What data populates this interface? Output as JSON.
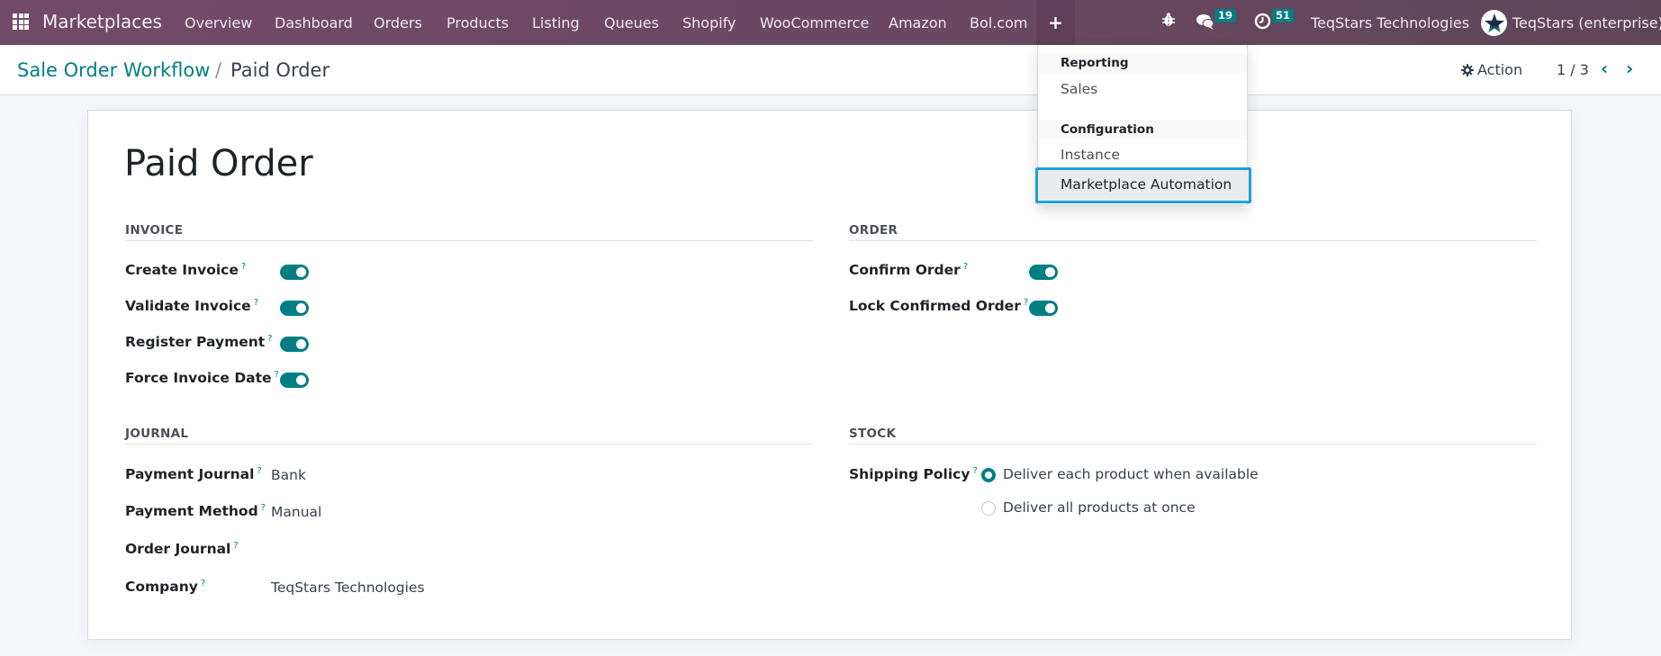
{
  "navbar": {
    "brand": "Marketplaces",
    "menu": [
      "Overview",
      "Dashboard",
      "Orders",
      "Products",
      "Listing",
      "Queues",
      "Shopify",
      "WooCommerce",
      "Amazon",
      "Bol.com"
    ],
    "plus_icon": "plus-icon",
    "messages_count": "19",
    "activities_count": "51",
    "company": "TeqStars Technologies",
    "user": "TeqStars (enterprise)"
  },
  "control_panel": {
    "breadcrumb_parent": "Sale Order Workflow",
    "breadcrumb_sep": "/",
    "breadcrumb_current": "Paid Order",
    "action_label": "Action",
    "pager": "1 / 3"
  },
  "dropdown": {
    "sections": [
      {
        "header": "Reporting",
        "items": [
          "Sales"
        ]
      },
      {
        "header": "Configuration",
        "items": [
          "Instance",
          "Marketplace Automation"
        ]
      }
    ],
    "focused_item": "Marketplace Automation"
  },
  "form": {
    "title": "Paid Order",
    "invoice": {
      "heading": "INVOICE",
      "fields": [
        {
          "label": "Create Invoice",
          "help": "?",
          "enabled": true
        },
        {
          "label": "Validate Invoice",
          "help": "?",
          "enabled": true
        },
        {
          "label": "Register Payment",
          "help": "?",
          "enabled": true
        },
        {
          "label": "Force Invoice Date",
          "help": "?",
          "enabled": true
        }
      ]
    },
    "order": {
      "heading": "ORDER",
      "fields": [
        {
          "label": "Confirm Order",
          "help": "?",
          "enabled": true
        },
        {
          "label": "Lock Confirmed Order",
          "help": "?",
          "enabled": true
        }
      ]
    },
    "journal": {
      "heading": "JOURNAL",
      "fields": [
        {
          "label": "Payment Journal",
          "help": "?",
          "value": "Bank"
        },
        {
          "label": "Payment Method",
          "help": "?",
          "value": "Manual"
        },
        {
          "label": "Order Journal",
          "help": "?",
          "value": ""
        },
        {
          "label": "Company",
          "help": "?",
          "value": "TeqStars Technologies"
        }
      ]
    },
    "stock": {
      "heading": "STOCK",
      "shipping_policy_label": "Shipping Policy",
      "help": "?",
      "options": [
        {
          "label": "Deliver each product when available",
          "selected": true
        },
        {
          "label": "Deliver all products at once",
          "selected": false
        }
      ]
    }
  },
  "colors": {
    "navbar": "#714b67",
    "accent": "#017e84",
    "focus_ring": "#1ea0dc"
  }
}
